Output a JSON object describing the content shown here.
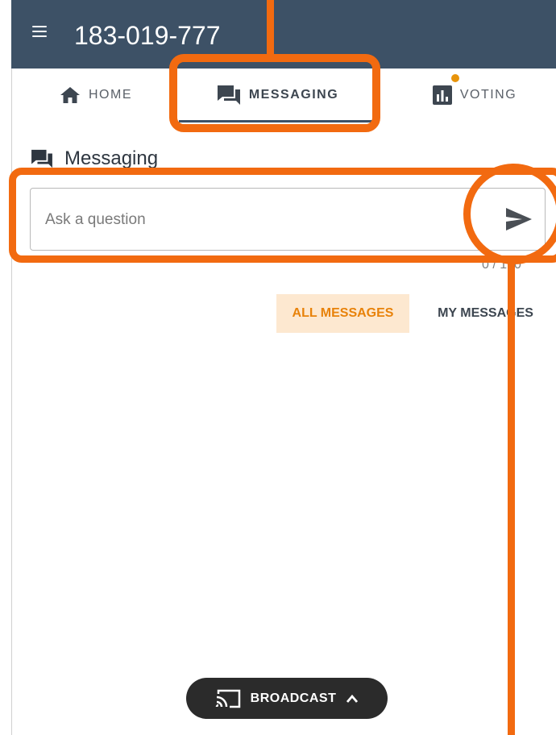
{
  "header": {
    "session_id": "183-019-777"
  },
  "tabs": [
    {
      "label": "HOME",
      "icon": "home-icon",
      "active": false
    },
    {
      "label": "MESSAGING",
      "icon": "chat-icon",
      "active": true
    },
    {
      "label": "VOTING",
      "icon": "bar-chart-icon",
      "active": false,
      "has_notification": true
    }
  ],
  "messaging": {
    "title": "Messaging",
    "input_placeholder": "Ask a question",
    "char_count": "0 / 160"
  },
  "filters": {
    "all_label": "ALL MESSAGES",
    "mine_label": "MY MESSAGES"
  },
  "broadcast": {
    "label": "BROADCAST"
  },
  "colors": {
    "header_bg": "#3d5166",
    "accent_orange": "#e8820a",
    "annotation": "#f26a10",
    "notification_dot": "#e8940a"
  }
}
